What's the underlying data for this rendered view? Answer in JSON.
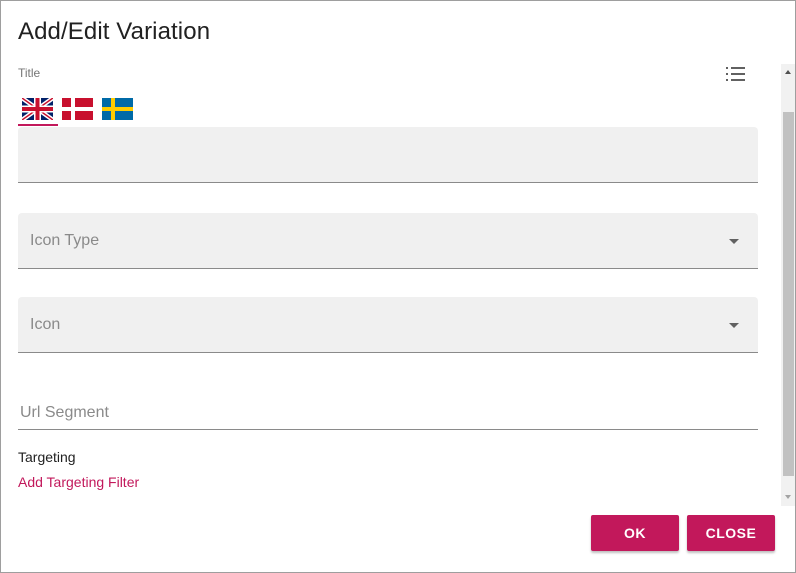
{
  "dialog": {
    "title": "Add/Edit Variation"
  },
  "form": {
    "title_label": "Title",
    "list_icon": "list-icon",
    "languages": [
      {
        "code": "en",
        "flag": "uk-flag-icon",
        "active": true
      },
      {
        "code": "da",
        "flag": "denmark-flag-icon",
        "active": false
      },
      {
        "code": "sv",
        "flag": "sweden-flag-icon",
        "active": false
      }
    ],
    "title_value": "",
    "icon_type_label": "Icon Type",
    "icon_label": "Icon",
    "url_segment_placeholder": "Url Segment",
    "targeting_label": "Targeting",
    "add_targeting_filter": "Add Targeting Filter"
  },
  "actions": {
    "ok_label": "OK",
    "close_label": "CLOSE"
  },
  "colors": {
    "accent": "#c2185b",
    "field_bg": "#f0f0f0"
  }
}
